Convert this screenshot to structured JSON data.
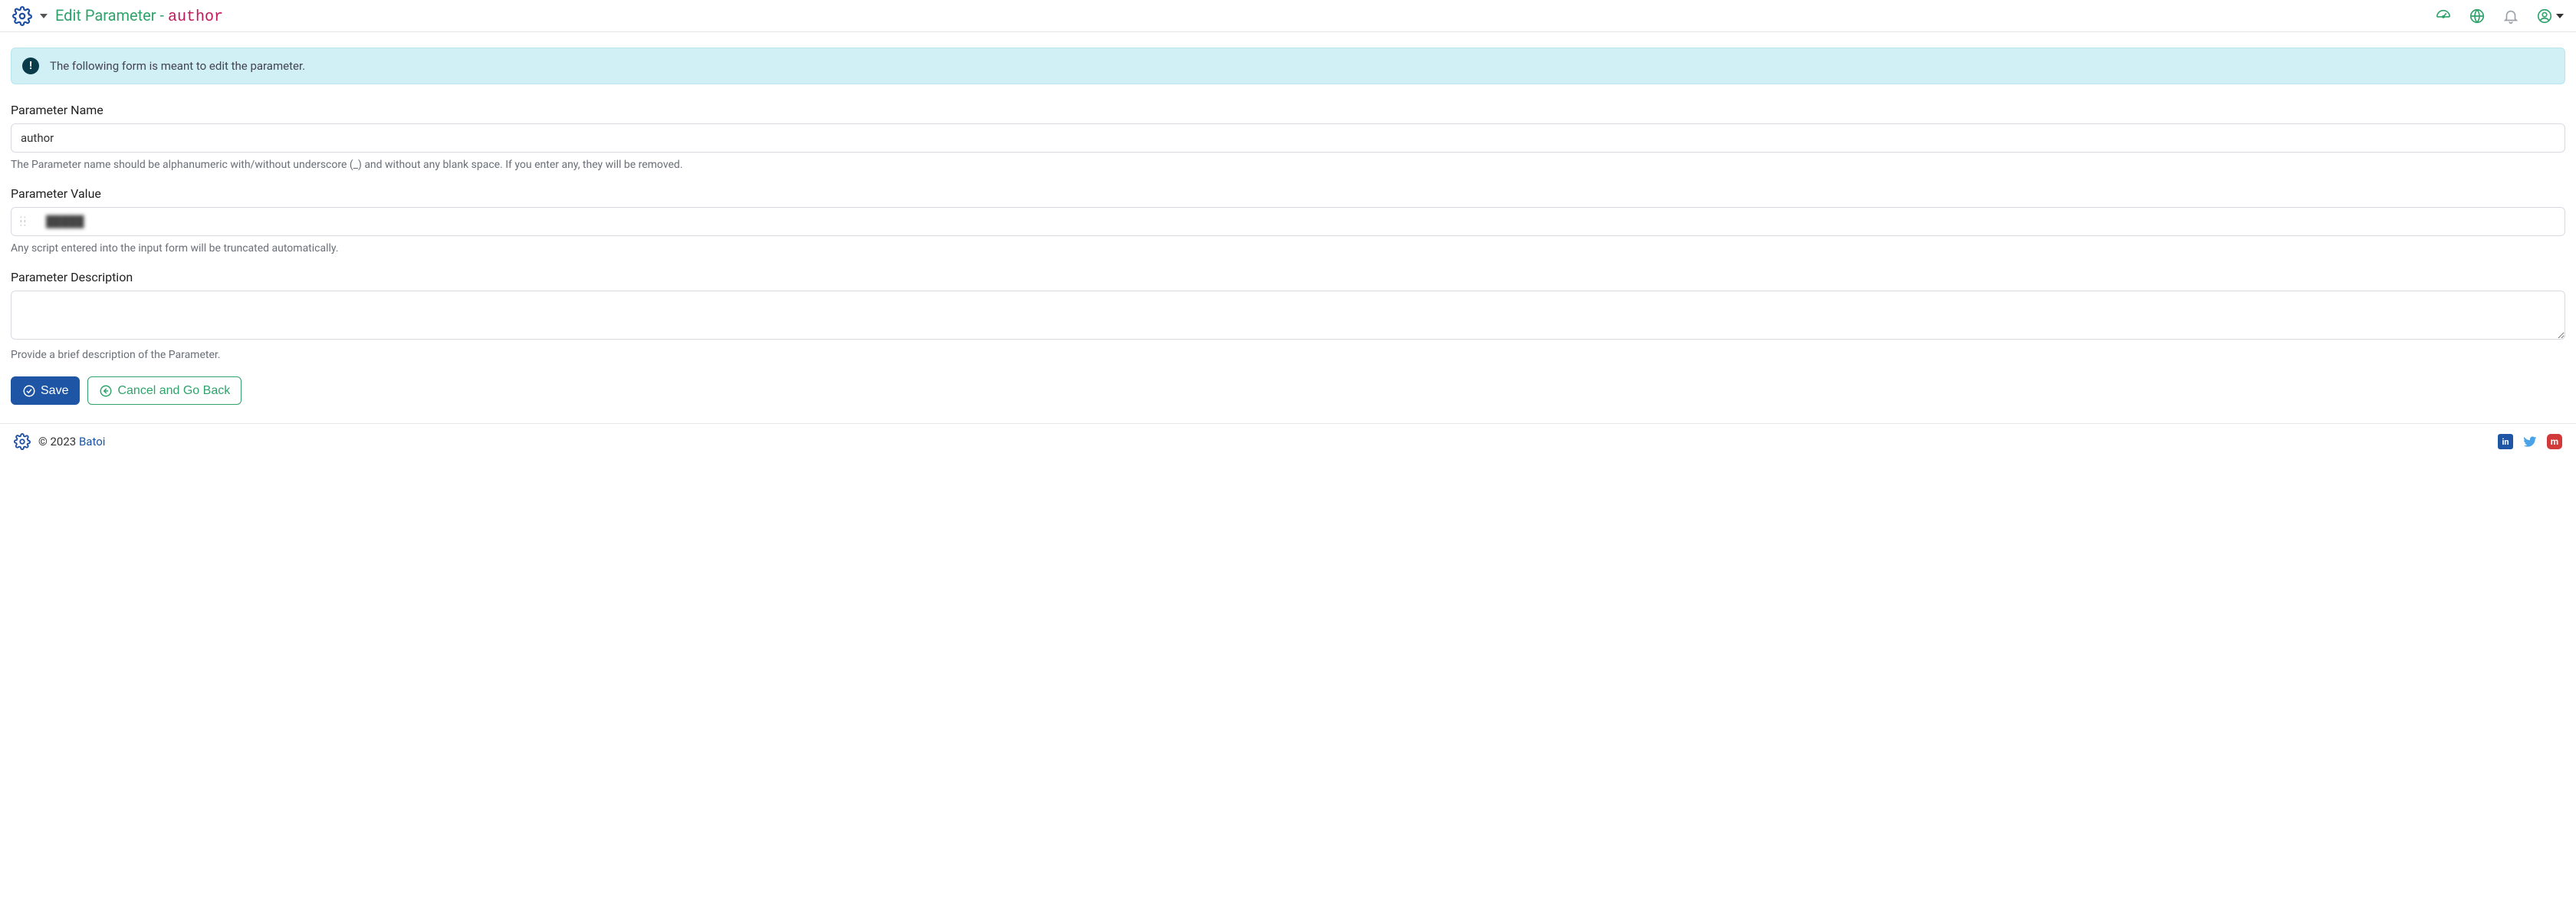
{
  "header": {
    "title_prefix": "Edit Parameter",
    "title_separator": " - ",
    "title_param": "author"
  },
  "banner": {
    "text": "The following form is meant to edit the parameter."
  },
  "form": {
    "name_label": "Parameter Name",
    "name_value": "author",
    "name_help": "The Parameter name should be alphanumeric with/without underscore (_) and without any blank space. If you enter any, they will be removed.",
    "value_label": "Parameter Value",
    "value_value": "",
    "value_masked_preview": "█████",
    "value_help": "Any script entered into the input form will be truncated automatically.",
    "desc_label": "Parameter Description",
    "desc_value": "",
    "desc_help": "Provide a brief description of the Parameter."
  },
  "buttons": {
    "save": "Save",
    "cancel": "Cancel and Go Back"
  },
  "footer": {
    "copyright": "© 2023 ",
    "brand": "Batoi"
  },
  "icons": {
    "info_glyph": "!",
    "linkedin_glyph": "in",
    "mastodon_glyph": "m"
  }
}
